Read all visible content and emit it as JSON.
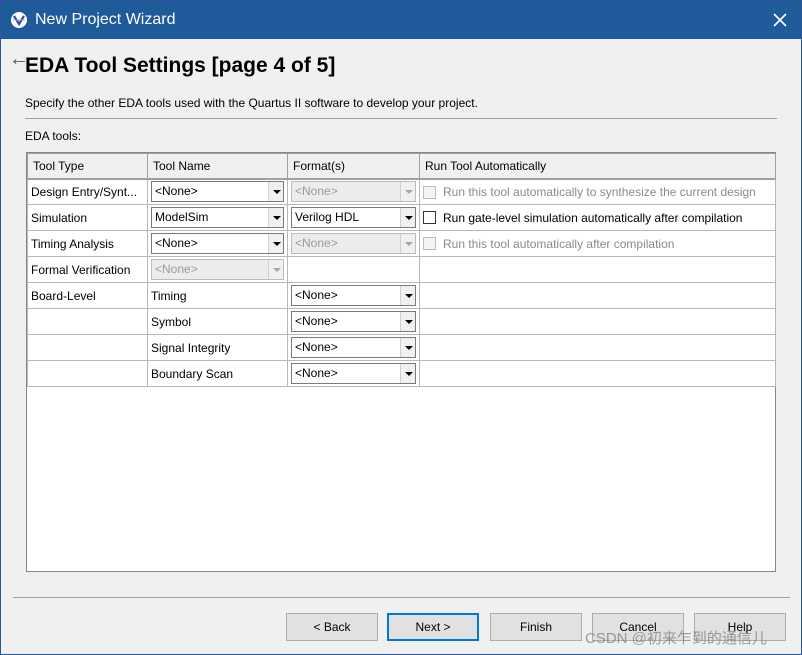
{
  "window": {
    "title": "New Project Wizard",
    "close_glyph": "✕",
    "title_bar_color": "#1f5a9a"
  },
  "page": {
    "heading": "EDA Tool Settings [page 4 of 5]",
    "description": "Specify the other EDA tools used with the Quartus II software to develop your project.",
    "tools_label": "EDA tools:"
  },
  "table": {
    "headers": [
      "Tool Type",
      "Tool Name",
      "Format(s)",
      "Run Tool Automatically"
    ],
    "rows": [
      {
        "type": "Design Entry/Synt...",
        "tool": "<None>",
        "format": "<None>",
        "run": "Run this tool automatically to synthesize the current design"
      },
      {
        "type": "Simulation",
        "tool": "ModelSim",
        "format": "Verilog HDL",
        "run": "Run gate-level simulation automatically after compilation"
      },
      {
        "type": "Timing Analysis",
        "tool": "<None>",
        "format": "<None>",
        "run": "Run this tool automatically after compilation"
      },
      {
        "type": "Formal Verification",
        "tool": "<None>"
      },
      {
        "type": "Board-Level",
        "sub": "Timing",
        "format": "<None>"
      },
      {
        "sub": "Symbol",
        "format": "<None>"
      },
      {
        "sub": "Signal Integrity",
        "format": "<None>"
      },
      {
        "sub": "Boundary Scan",
        "format": "<None>"
      }
    ]
  },
  "buttons": {
    "back": "< Back",
    "next": "Next >",
    "finish": "Finish",
    "cancel": "Cancel",
    "help": "Help"
  },
  "watermark": "CSDN @初来乍到的通信儿"
}
